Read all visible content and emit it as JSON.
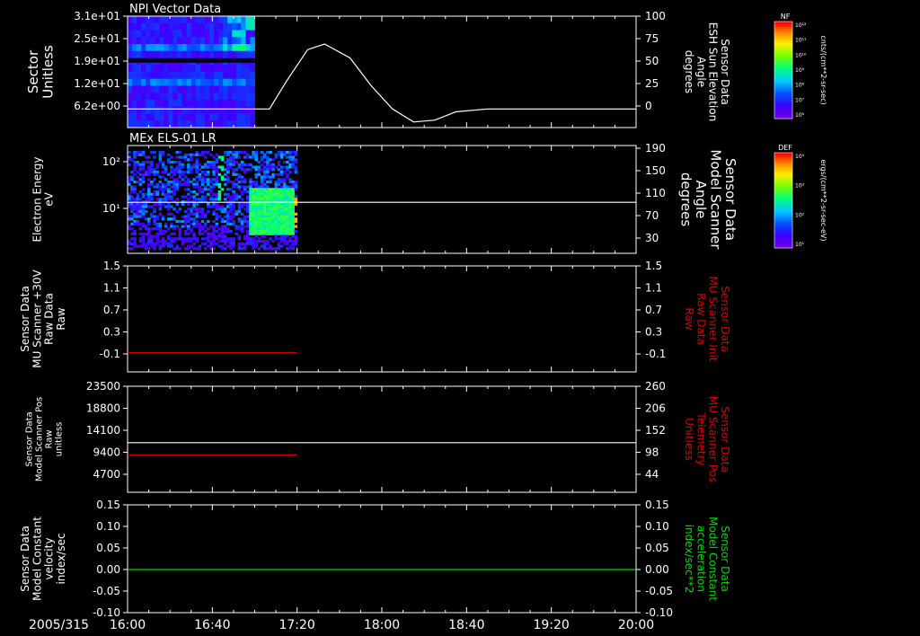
{
  "colors": {
    "background": "#000000",
    "axes": "#ffffff",
    "red": "#e00000",
    "green": "#00dd00",
    "white": "#ffffff"
  },
  "date_label": "2005/315",
  "time_ticks": [
    "16:00",
    "16:40",
    "17:20",
    "18:00",
    "18:40",
    "19:20",
    "20:00"
  ],
  "chart_data": [
    {
      "type": "heatmap",
      "panel": 1,
      "title": "NPI Vector Data",
      "left_axis": {
        "label_lines": [
          "Sector",
          "Unitless"
        ],
        "ticks": [
          "3.1e+01",
          "2.5e+01",
          "1.9e+01",
          "1.2e+01",
          "6.2e+00"
        ]
      },
      "right_axis": {
        "label_lines": [
          "Sensor Data",
          "ESH Sun Elevation",
          "Angle",
          "degrees"
        ],
        "ticks": [
          "100",
          "75",
          "50",
          "25",
          "0"
        ],
        "ylim": [
          -20,
          100
        ]
      },
      "heatmap_time_range": [
        "16:00",
        "17:00"
      ],
      "line_series": {
        "name": "ESH Sun Elevation Angle",
        "color": "white",
        "x": [
          "16:00",
          "17:00",
          "17:07",
          "17:15",
          "17:25",
          "17:33",
          "17:45",
          "17:55",
          "18:05",
          "18:15",
          "18:25",
          "18:35",
          "18:50",
          "20:00"
        ],
        "y": [
          0,
          0,
          0,
          30,
          64,
          70,
          55,
          25,
          0,
          -14,
          -12,
          -3,
          0,
          0
        ]
      },
      "colorbar": {
        "label": "NF",
        "unit": "cnts/(cm**2-sr-sec)",
        "ticks": [
          "10¹²",
          "10¹¹",
          "10¹⁰",
          "10⁹",
          "10⁸",
          "10⁷",
          "10⁶"
        ]
      }
    },
    {
      "type": "heatmap",
      "panel": 2,
      "title": "MEx ELS-01 LR",
      "left_axis": {
        "label_lines": [
          "Electron Energy",
          "eV"
        ],
        "ticks": [
          "10²",
          "10¹"
        ],
        "scale": "log"
      },
      "right_axis": {
        "label_lines": [
          "Sensor Data",
          "Model Scanner",
          "Angle",
          "degrees"
        ],
        "ticks": [
          "190",
          "150",
          "110",
          "70",
          "30"
        ],
        "ylim": [
          0,
          190
        ]
      },
      "heatmap_time_range": [
        "16:00",
        "17:20"
      ],
      "line_series": {
        "name": "Model Scanner Angle",
        "color": "white",
        "x": [
          "16:00",
          "20:00"
        ],
        "y": [
          90,
          90
        ]
      },
      "colorbar": {
        "label": "DEF",
        "unit": "ergs/(cm**2-sr-sec-eV)",
        "ticks": [
          "10⁴",
          "10³",
          "10²",
          "10¹"
        ]
      }
    },
    {
      "type": "line",
      "panel": 3,
      "left_axis": {
        "label_lines": [
          "Sensor Data",
          "MU Scanner +30V",
          "Raw Data",
          "Raw"
        ],
        "ticks": [
          "1.5",
          "1.1",
          "0.7",
          "0.3",
          "-0.1"
        ],
        "ylim": [
          -0.33,
          1.5
        ]
      },
      "right_axis": {
        "label_lines": [
          "Sensor Data",
          "MU Scanner Init",
          "Raw Data",
          "Raw"
        ],
        "ticks": [
          "1.5",
          "1.1",
          "0.7",
          "0.3",
          "-0.1"
        ],
        "color": "red"
      },
      "series": [
        {
          "color": "red",
          "x": [
            "16:00",
            "17:20"
          ],
          "y": [
            0.0,
            0.0
          ]
        }
      ]
    },
    {
      "type": "line",
      "panel": 4,
      "left_axis": {
        "label_lines": [
          "Sensor Data",
          "Model Scanner Pos",
          "Raw",
          "unitless"
        ],
        "ticks": [
          "23500",
          "18800",
          "14100",
          "9400",
          "4700"
        ],
        "ylim": [
          0,
          23500
        ]
      },
      "right_axis": {
        "label_lines": [
          "Sensor Data",
          "MU Scanner Pos",
          "Telemetry",
          "Unitless"
        ],
        "ticks": [
          "260",
          "206",
          "152",
          "98",
          "44"
        ],
        "color": "red"
      },
      "series": [
        {
          "color": "white",
          "x": [
            "16:00",
            "20:00"
          ],
          "y": [
            11000,
            11000
          ]
        },
        {
          "color": "red",
          "x": [
            "16:00",
            "17:20"
          ],
          "y": [
            8300,
            8300
          ]
        }
      ]
    },
    {
      "type": "line",
      "panel": 5,
      "left_axis": {
        "label_lines": [
          "Sensor Data",
          "Model Constant",
          "velocity",
          "index/sec"
        ],
        "ticks": [
          "0.15",
          "0.10",
          "0.05",
          "0.00",
          "-0.05",
          "-0.10"
        ],
        "ylim": [
          -0.1,
          0.15
        ]
      },
      "right_axis": {
        "label_lines": [
          "Sensor Data",
          "Model Constant",
          "acceleration",
          "index/sec**2"
        ],
        "ticks": [
          "0.15",
          "0.10",
          "0.05",
          "0.00",
          "-0.05",
          "-0.10"
        ],
        "color": "green"
      },
      "series": [
        {
          "color": "green",
          "x": [
            "16:00",
            "20:00"
          ],
          "y": [
            0,
            0
          ]
        }
      ]
    }
  ]
}
